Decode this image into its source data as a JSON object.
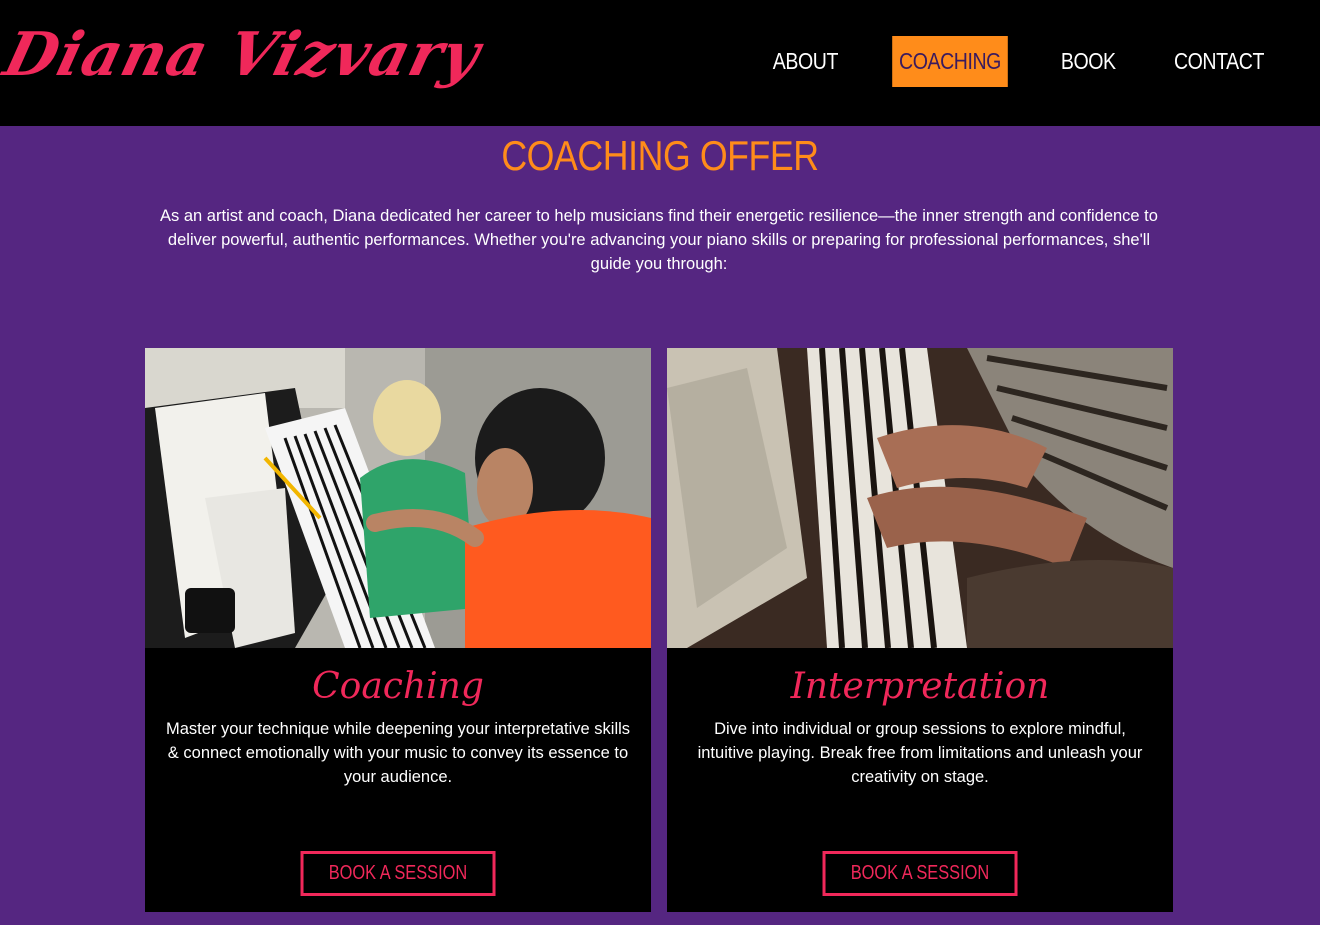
{
  "header": {
    "logo_text": "Diana Vizvary",
    "nav": [
      {
        "label": "ABOUT"
      },
      {
        "label": "COACHING",
        "active": true
      },
      {
        "label": "BOOK"
      },
      {
        "label": "CONTACT"
      }
    ]
  },
  "main": {
    "title": "COACHING OFFER",
    "intro": "As an artist and coach, Diana dedicated her career to help musicians find their energetic resilience—the inner strength and confidence to deliver powerful, authentic performances. Whether you're advancing your piano skills or preparing for professional performances, she'll guide you through:"
  },
  "cards": [
    {
      "heading": "Coaching",
      "text": "Master your technique while deepening your interpretative skills & connect emotionally with your music to convey its essence to your audience.",
      "button": "BOOK A SESSION"
    },
    {
      "heading": "Interpretation",
      "text": "Dive into individual or group sessions to explore mindful, intuitive playing. Break free from limitations and unleash your creativity on stage.",
      "button": "BOOK A SESSION"
    }
  ],
  "colors": {
    "accent_orange": "#ff8c1a",
    "accent_pink": "#f0285a",
    "background_purple": "#552681",
    "header_black": "#000000"
  }
}
